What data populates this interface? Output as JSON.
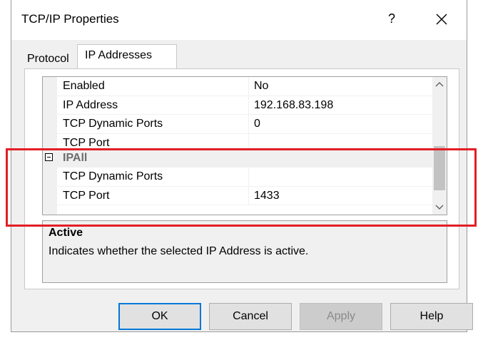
{
  "window": {
    "title": "TCP/IP Properties",
    "help_glyph": "?",
    "close_icon": "close-icon"
  },
  "tabs": [
    {
      "label": "Protocol",
      "active": false
    },
    {
      "label": "IP Addresses",
      "active": true
    }
  ],
  "grid": {
    "rows": [
      {
        "name": "Enabled",
        "value": "No"
      },
      {
        "name": "IP Address",
        "value": "192.168.83.198"
      },
      {
        "name": "TCP Dynamic Ports",
        "value": "0"
      },
      {
        "name": "TCP Port",
        "value": ""
      }
    ],
    "category": {
      "label": "IPAll",
      "expanded": true
    },
    "ipall_rows": [
      {
        "name": "TCP Dynamic Ports",
        "value": ""
      },
      {
        "name": "TCP Port",
        "value": "1433"
      }
    ]
  },
  "description": {
    "title": "Active",
    "text": "Indicates whether the selected IP Address is active."
  },
  "buttons": {
    "ok": "OK",
    "cancel": "Cancel",
    "apply": "Apply",
    "help": "Help"
  },
  "highlight_color": "#e31e24",
  "accent_color": "#0078d7"
}
